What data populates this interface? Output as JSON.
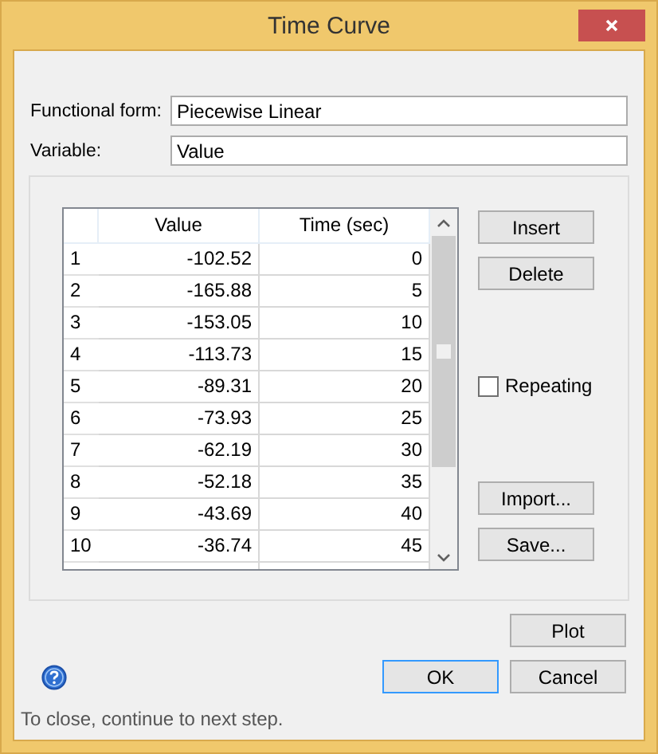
{
  "window": {
    "title": "Time Curve"
  },
  "fields": [
    {
      "label": "Functional form:",
      "value": "Piecewise Linear"
    },
    {
      "label": "Variable:",
      "value": "Value"
    }
  ],
  "table": {
    "columns": [
      "Value",
      "Time (sec)"
    ],
    "rows": [
      {
        "index": "1",
        "cells": [
          "-102.52",
          "0"
        ]
      },
      {
        "index": "2",
        "cells": [
          "-165.88",
          "5"
        ]
      },
      {
        "index": "3",
        "cells": [
          "-153.05",
          "10"
        ]
      },
      {
        "index": "4",
        "cells": [
          "-113.73",
          "15"
        ]
      },
      {
        "index": "5",
        "cells": [
          "-89.31",
          "20"
        ]
      },
      {
        "index": "6",
        "cells": [
          "-73.93",
          "25"
        ]
      },
      {
        "index": "7",
        "cells": [
          "-62.19",
          "30"
        ]
      },
      {
        "index": "8",
        "cells": [
          "-52.18",
          "35"
        ]
      },
      {
        "index": "9",
        "cells": [
          "-43.69",
          "40"
        ]
      },
      {
        "index": "10",
        "cells": [
          "-36.74",
          "45"
        ]
      }
    ]
  },
  "edit_buttons": [
    "Insert",
    "Delete"
  ],
  "repeating": {
    "label": "Repeating",
    "checked": false
  },
  "file_buttons": [
    "Import...",
    "Save..."
  ],
  "plot_button": "Plot",
  "buttons": [
    {
      "label": "OK",
      "default": true
    },
    {
      "label": "Cancel",
      "default": false
    }
  ],
  "status_text": "To close, continue to next step."
}
